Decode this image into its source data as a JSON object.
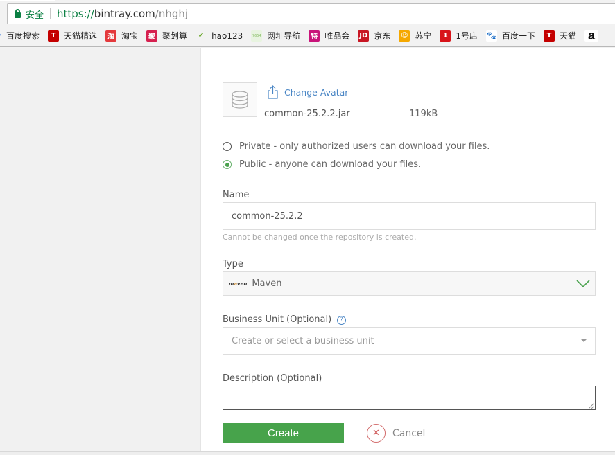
{
  "browser": {
    "security_label": "安全",
    "url_scheme": "https://",
    "url_host": "bintray.com",
    "url_path": "/nhghj"
  },
  "bookmarks": [
    {
      "label": "百度搜索",
      "icon": "baidu-search-icon",
      "color": "#2a6fd6",
      "glyph": "•"
    },
    {
      "label": "天猫精选",
      "icon": "tmall-icon",
      "color": "#c40000",
      "glyph": "T"
    },
    {
      "label": "淘宝",
      "icon": "taobao-icon",
      "color": "#e4393c",
      "glyph": "淘"
    },
    {
      "label": "聚划算",
      "icon": "juhuasuan-icon",
      "color": "#d6204f",
      "glyph": "聚"
    },
    {
      "label": "hao123",
      "icon": "hao123-icon",
      "color": "#6aa82c",
      "glyph": "✔"
    },
    {
      "label": "网址导航",
      "icon": "7654-icon",
      "color": "#e8f4e0",
      "glyph": "7654"
    },
    {
      "label": "唯品会",
      "icon": "vip-icon",
      "color": "#c9147a",
      "glyph": "特"
    },
    {
      "label": "京东",
      "icon": "jd-icon",
      "color": "#c81623",
      "glyph": "JD"
    },
    {
      "label": "苏宁",
      "icon": "suning-icon",
      "color": "#f5a800",
      "glyph": "☺"
    },
    {
      "label": "1号店",
      "icon": "yhd-icon",
      "color": "#d8141a",
      "glyph": "1"
    },
    {
      "label": "百度一下",
      "icon": "baidu-paw-icon",
      "color": "#ffffff",
      "glyph": "🐾"
    },
    {
      "label": "天猫",
      "icon": "tmall-icon",
      "color": "#c40000",
      "glyph": "T"
    },
    {
      "label": "",
      "icon": "amazon-icon",
      "color": "#ffffff",
      "glyph": "a"
    }
  ],
  "form": {
    "change_avatar_label": "Change Avatar",
    "file_name": "common-25.2.2.jar",
    "file_size": "119kB",
    "visibility": {
      "private_label": "Private - only authorized users can download your files.",
      "public_label": "Public - anyone can download your files.",
      "selected": "public"
    },
    "name_label": "Name",
    "name_value": "common-25.2.2",
    "name_hint": "Cannot be changed once the repository is created.",
    "type_label": "Type",
    "type_value": "Maven",
    "type_logo_text": "maven",
    "business_unit_label": "Business Unit (Optional)",
    "business_unit_placeholder": "Create or select a business unit",
    "description_label": "Description (Optional)",
    "description_value": "",
    "create_label": "Create",
    "cancel_label": "Cancel"
  },
  "colors": {
    "accent_green": "#47a34b",
    "link_blue": "#4a86c5",
    "cancel_red": "#d05a5a"
  }
}
